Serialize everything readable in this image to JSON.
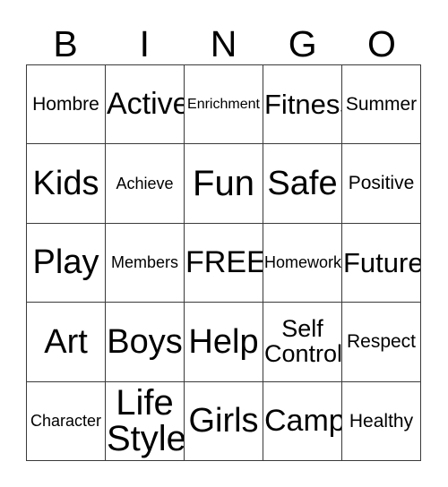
{
  "card": {
    "type": "bingo-card",
    "header_letters": [
      "B",
      "I",
      "N",
      "G",
      "O"
    ],
    "grid_size": "5x5",
    "free_space": "FREE!",
    "colors": {
      "background": "#ffffff",
      "text": "#000000",
      "grid_line": "#3a3a3a"
    },
    "cells": [
      [
        {
          "text": "Hombre",
          "size": "fs-md"
        },
        {
          "text": "Active",
          "size": "fs-xxl"
        },
        {
          "text": "Enrichment",
          "size": "fs-xs"
        },
        {
          "text": "Fitness",
          "size": "fs-xl"
        },
        {
          "text": "Summer",
          "size": "fs-md"
        }
      ],
      [
        {
          "text": "Kids",
          "size": "fs-huge"
        },
        {
          "text": "Achieve",
          "size": "fs-sm"
        },
        {
          "text": "Fun",
          "size": "fs-max"
        },
        {
          "text": "Safe",
          "size": "fs-huge"
        },
        {
          "text": "Positive",
          "size": "fs-md"
        }
      ],
      [
        {
          "text": "Play",
          "size": "fs-huge"
        },
        {
          "text": "Members",
          "size": "fs-sm"
        },
        {
          "text": "FREE!",
          "size": "fs-xxl"
        },
        {
          "text": "Homework",
          "size": "fs-sm"
        },
        {
          "text": "Future",
          "size": "fs-xl"
        }
      ],
      [
        {
          "text": "Art",
          "size": "fs-huge"
        },
        {
          "text": "Boys",
          "size": "fs-huge"
        },
        {
          "text": "Help",
          "size": "fs-huge"
        },
        {
          "text": "Self\nControl",
          "size": "fs-lg"
        },
        {
          "text": "Respect",
          "size": "fs-md"
        }
      ],
      [
        {
          "text": "Character",
          "size": "fs-sm"
        },
        {
          "text": "Life\nStyle",
          "size": "fs-max"
        },
        {
          "text": "Girls",
          "size": "fs-huge"
        },
        {
          "text": "Camp",
          "size": "fs-xxl"
        },
        {
          "text": "Healthy",
          "size": "fs-md"
        }
      ]
    ]
  }
}
